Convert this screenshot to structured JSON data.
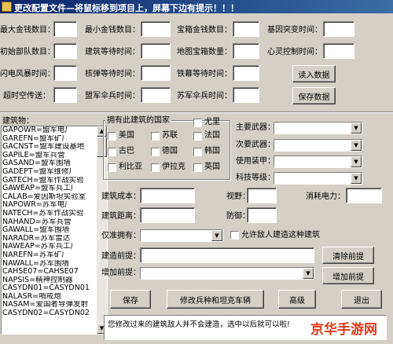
{
  "title": "更改配置文件—将鼠标移到项目上，屏幕下边有提示！！！",
  "top_fields": [
    {
      "label": "最大金钱数目：",
      "value": ""
    },
    {
      "label": "最小金钱数目：",
      "value": ""
    },
    {
      "label": "宝箱金钱数目：",
      "value": ""
    },
    {
      "label": "基因突变时间：",
      "value": ""
    },
    {
      "label": "初始部队数目：",
      "value": ""
    },
    {
      "label": "建筑等待时间：",
      "value": ""
    },
    {
      "label": "地图宝箱数量：",
      "value": ""
    },
    {
      "label": "心灵控制时间：",
      "value": ""
    },
    {
      "label": "闪电风暴时间：",
      "value": ""
    },
    {
      "label": "核弹等待时间：",
      "value": ""
    },
    {
      "label": "铁幕等待时间：",
      "value": ""
    },
    {
      "label": "超时空传送：",
      "value": ""
    },
    {
      "label": "盟军伞兵时间：",
      "value": ""
    },
    {
      "label": "苏军伞兵时间：",
      "value": ""
    }
  ],
  "buttons_top": {
    "read": "读入数据",
    "save": "保存数据"
  },
  "building_label": "建筑物：",
  "buildings": [
    "GAPOWR=盟军电厂",
    "GAREFN=盟军矿厂",
    "GACNST=盟军建设基地",
    "GAPILE=盟军兵营",
    "GASAND=盟军围墙",
    "GADEPT=盟军维修厂",
    "GATECH=盟军作战实验",
    "GAWEAP=盟军兵工厂",
    "CALAB=爱因斯坦实验室",
    "NAPOWR=苏军电厂",
    "NATECH=苏军作战实验",
    "NAHAND=苏军兵营",
    "GAWALL=盟军围墙",
    "NARADR=苏军雷达",
    "NAWEAP=苏军兵工厂",
    "NAREFN=苏军矿厂",
    "NAWALL=苏军围墙",
    "CAHSE07=CAHSE07",
    "NAPSIS=精神控制器",
    "CASYDN01=CASYDN01",
    "NALASR=哨戒炮",
    "NASAM=爱国者导弹发射",
    "CASYDN02=CASYDN02"
  ],
  "country_group": {
    "title": "拥有此建筑的国家",
    "countries": [
      "尤里",
      "美国",
      "苏联",
      "法国",
      "古巴",
      "德国",
      "韩国",
      "利比亚",
      "伊拉克",
      "英国"
    ]
  },
  "dropdowns": [
    {
      "label": "主要武器：",
      "value": ""
    },
    {
      "label": "次要武器：",
      "value": ""
    },
    {
      "label": "使用装甲：",
      "value": ""
    },
    {
      "label": "科技等级：",
      "value": ""
    }
  ],
  "props": {
    "cost": "建筑成本：",
    "sight": "视野：",
    "power": "消耗电力：",
    "distance": "建筑距离：",
    "defense": "防御："
  },
  "owner_label": "仅准拥有：",
  "allow_enemy": "允许敌人建造这种建筑",
  "prereq_label": "建造前提：",
  "clear_prereq": "清除前提",
  "add_prereq_label": "增加前提：",
  "add_prereq_btn": "增加前提",
  "bottom_buttons": [
    "保存",
    "修改兵种和坦克车辆",
    "高级",
    "退出"
  ],
  "status_message": "您修改过来的建筑敌人并不会建造，选中以后就可以啦!",
  "watermark": "京华手游网"
}
